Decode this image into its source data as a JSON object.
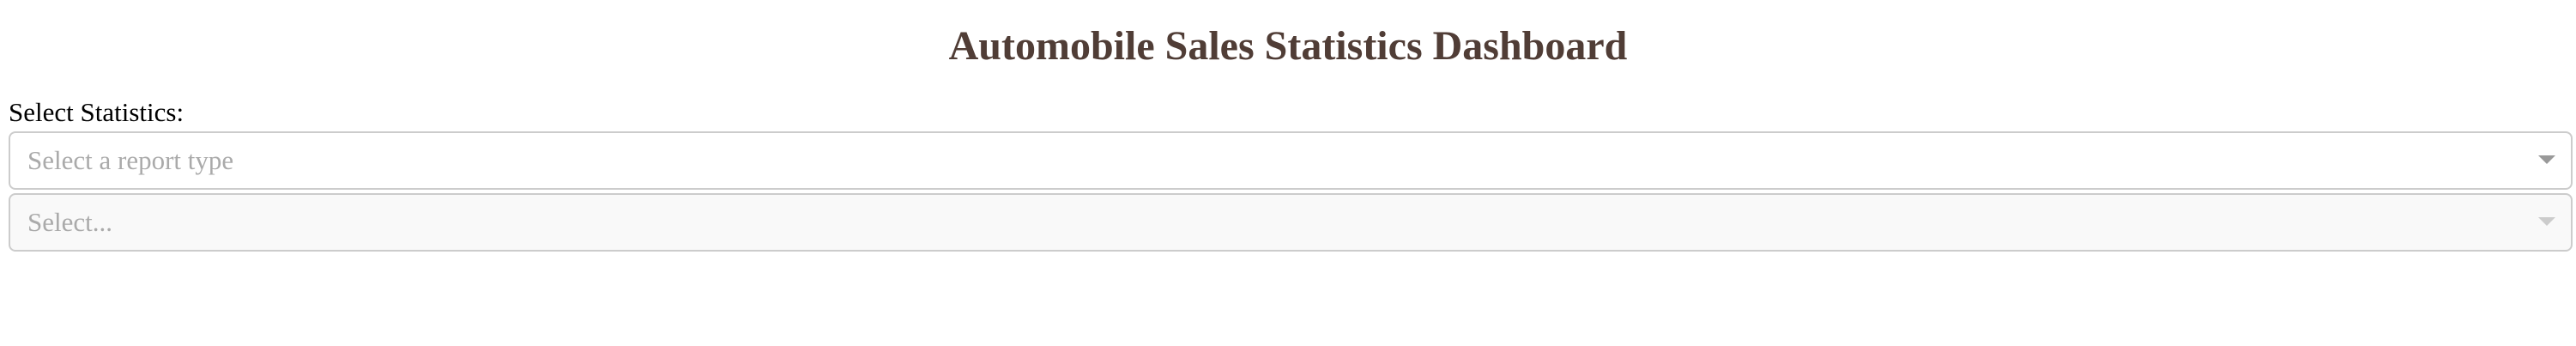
{
  "header": {
    "title": "Automobile Sales Statistics Dashboard"
  },
  "controls": {
    "statistics_label": "Select Statistics:",
    "report_type_dropdown": {
      "placeholder": "Select a report type",
      "value": ""
    },
    "year_dropdown": {
      "placeholder": "Select...",
      "value": "",
      "disabled": true
    }
  },
  "icons": {
    "dropdown_arrow": "chevron-down-icon"
  },
  "colors": {
    "title": "#503d36",
    "border": "#cccccc",
    "placeholder": "#aaaaaa",
    "disabled_background": "#f9f9f9"
  }
}
